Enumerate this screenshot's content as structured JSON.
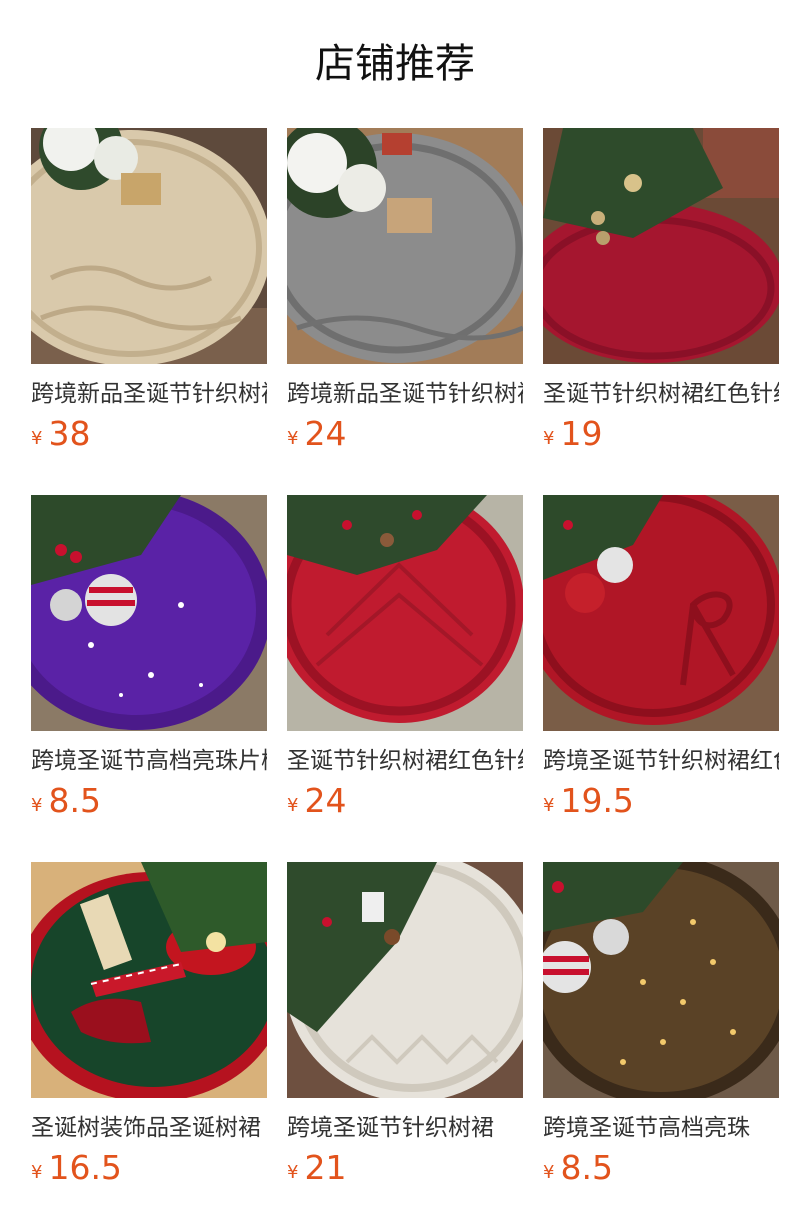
{
  "page": {
    "title": "店铺推荐"
  },
  "products": [
    {
      "name": "跨境新品圣诞节针织树裙",
      "currency": "¥",
      "price": "38",
      "image": "cream-knit-tree-skirt"
    },
    {
      "name": "跨境新品圣诞节针织树裙",
      "currency": "¥",
      "price": "24",
      "image": "grey-knit-tree-skirt"
    },
    {
      "name": "圣诞节针织树裙红色针织",
      "currency": "¥",
      "price": "19",
      "image": "red-knit-tree-skirt"
    },
    {
      "name": "跨境圣诞节高档亮珠片树裙",
      "currency": "¥",
      "price": "8.5",
      "image": "purple-sequin-tree-skirt"
    },
    {
      "name": "圣诞节针织树裙红色针织",
      "currency": "¥",
      "price": "24",
      "image": "red-cable-knit-tree-skirt"
    },
    {
      "name": "跨境圣诞节针织树裙红色",
      "currency": "¥",
      "price": "19.5",
      "image": "red-bow-knit-tree-skirt"
    },
    {
      "name": "圣诞树装饰品圣诞树裙",
      "currency": "¥",
      "price": "16.5",
      "image": "green-elf-tree-skirt"
    },
    {
      "name": "跨境圣诞节针织树裙",
      "currency": "¥",
      "price": "21",
      "image": "white-knit-tree-skirt"
    },
    {
      "name": "跨境圣诞节高档亮珠",
      "currency": "¥",
      "price": "8.5",
      "image": "gold-sequin-tree-skirt"
    }
  ]
}
